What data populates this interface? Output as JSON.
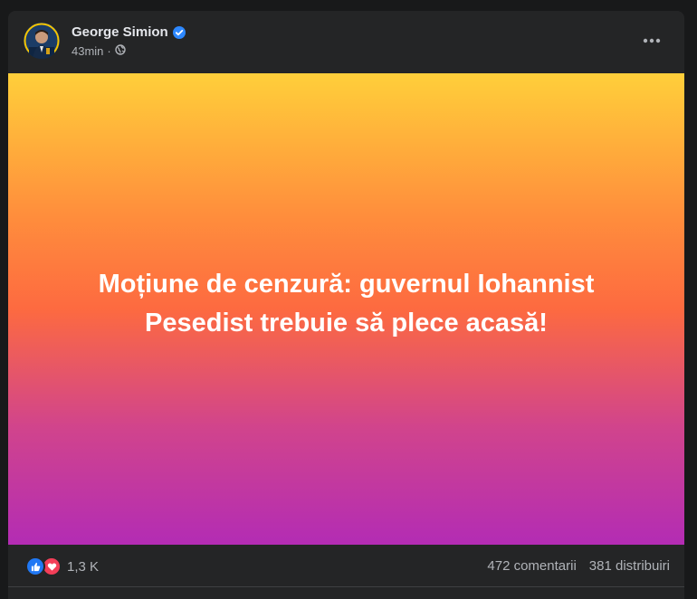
{
  "post": {
    "author": "George Simion",
    "time": "43min",
    "separator": "·",
    "audience_icon": "globe-icon",
    "verified_icon": "verified-badge-icon",
    "more_icon": "more-options-icon",
    "banner_text": "Moțiune de cenzură: guvernul Iohannist Pesedist trebuie să plece acasă!",
    "reactions": {
      "icons": [
        "like-icon",
        "love-icon"
      ],
      "count": "1,3 K"
    },
    "comments": "472 comentarii",
    "shares": "381 distribuiri"
  },
  "colors": {
    "background": "#18191a",
    "card": "#242526",
    "primary_text": "#e4e6eb",
    "secondary_text": "#b0b3b8",
    "like_blue": "#2078f4",
    "love_red": "#f33e58",
    "verified_blue": "#2d88ff",
    "gradient_top": "#ffcf3a",
    "gradient_mid": "#fd6a40",
    "gradient_bottom": "#b32cb4"
  }
}
